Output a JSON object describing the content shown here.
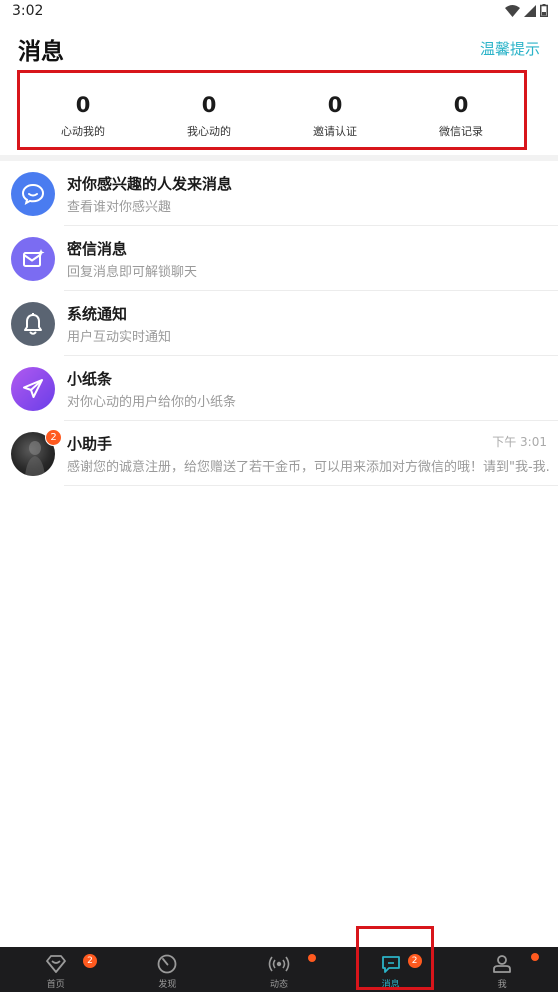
{
  "status_bar": {
    "time": "3:02"
  },
  "header": {
    "title": "消息",
    "tip_link": "温馨提示"
  },
  "stats": [
    {
      "value": "0",
      "label": "心动我的"
    },
    {
      "value": "0",
      "label": "我心动的"
    },
    {
      "value": "0",
      "label": "邀请认证"
    },
    {
      "value": "0",
      "label": "微信记录"
    }
  ],
  "messages": [
    {
      "title": "对你感兴趣的人发来消息",
      "subtitle": "查看谁对你感兴趣",
      "icon": "chat-bubble-icon",
      "color": "#4a7cf0"
    },
    {
      "title": "密信消息",
      "subtitle": "回复消息即可解锁聊天",
      "icon": "envelope-sparkle-icon",
      "color": "#7b6cf2"
    },
    {
      "title": "系统通知",
      "subtitle": "用户互动实时通知",
      "icon": "bell-icon",
      "color": "#5a6472"
    },
    {
      "title": "小纸条",
      "subtitle": "对你心动的用户给你的小纸条",
      "icon": "paper-plane-icon",
      "color": "#8d4ef0"
    },
    {
      "title": "小助手",
      "subtitle": "感谢您的诚意注册，给您赠送了若干金币，可以用来添加对方微信的哦！请到\"我-我...",
      "time": "下午 3:01",
      "badge": "2",
      "icon": "assistant-photo"
    }
  ],
  "nav": [
    {
      "label": "首页",
      "icon": "heart-diamond-icon",
      "badge": "2"
    },
    {
      "label": "发现",
      "icon": "compass-icon"
    },
    {
      "label": "动态",
      "icon": "broadcast-icon",
      "dot": true
    },
    {
      "label": "消息",
      "icon": "message-icon",
      "badge": "2",
      "active": true
    },
    {
      "label": "我",
      "icon": "user-icon",
      "dot": true
    }
  ],
  "colors": {
    "accent": "#2bb3c8",
    "badge": "#ff5a1f",
    "highlight_box": "#d8151b",
    "nav_bg": "#1c1c1e"
  }
}
